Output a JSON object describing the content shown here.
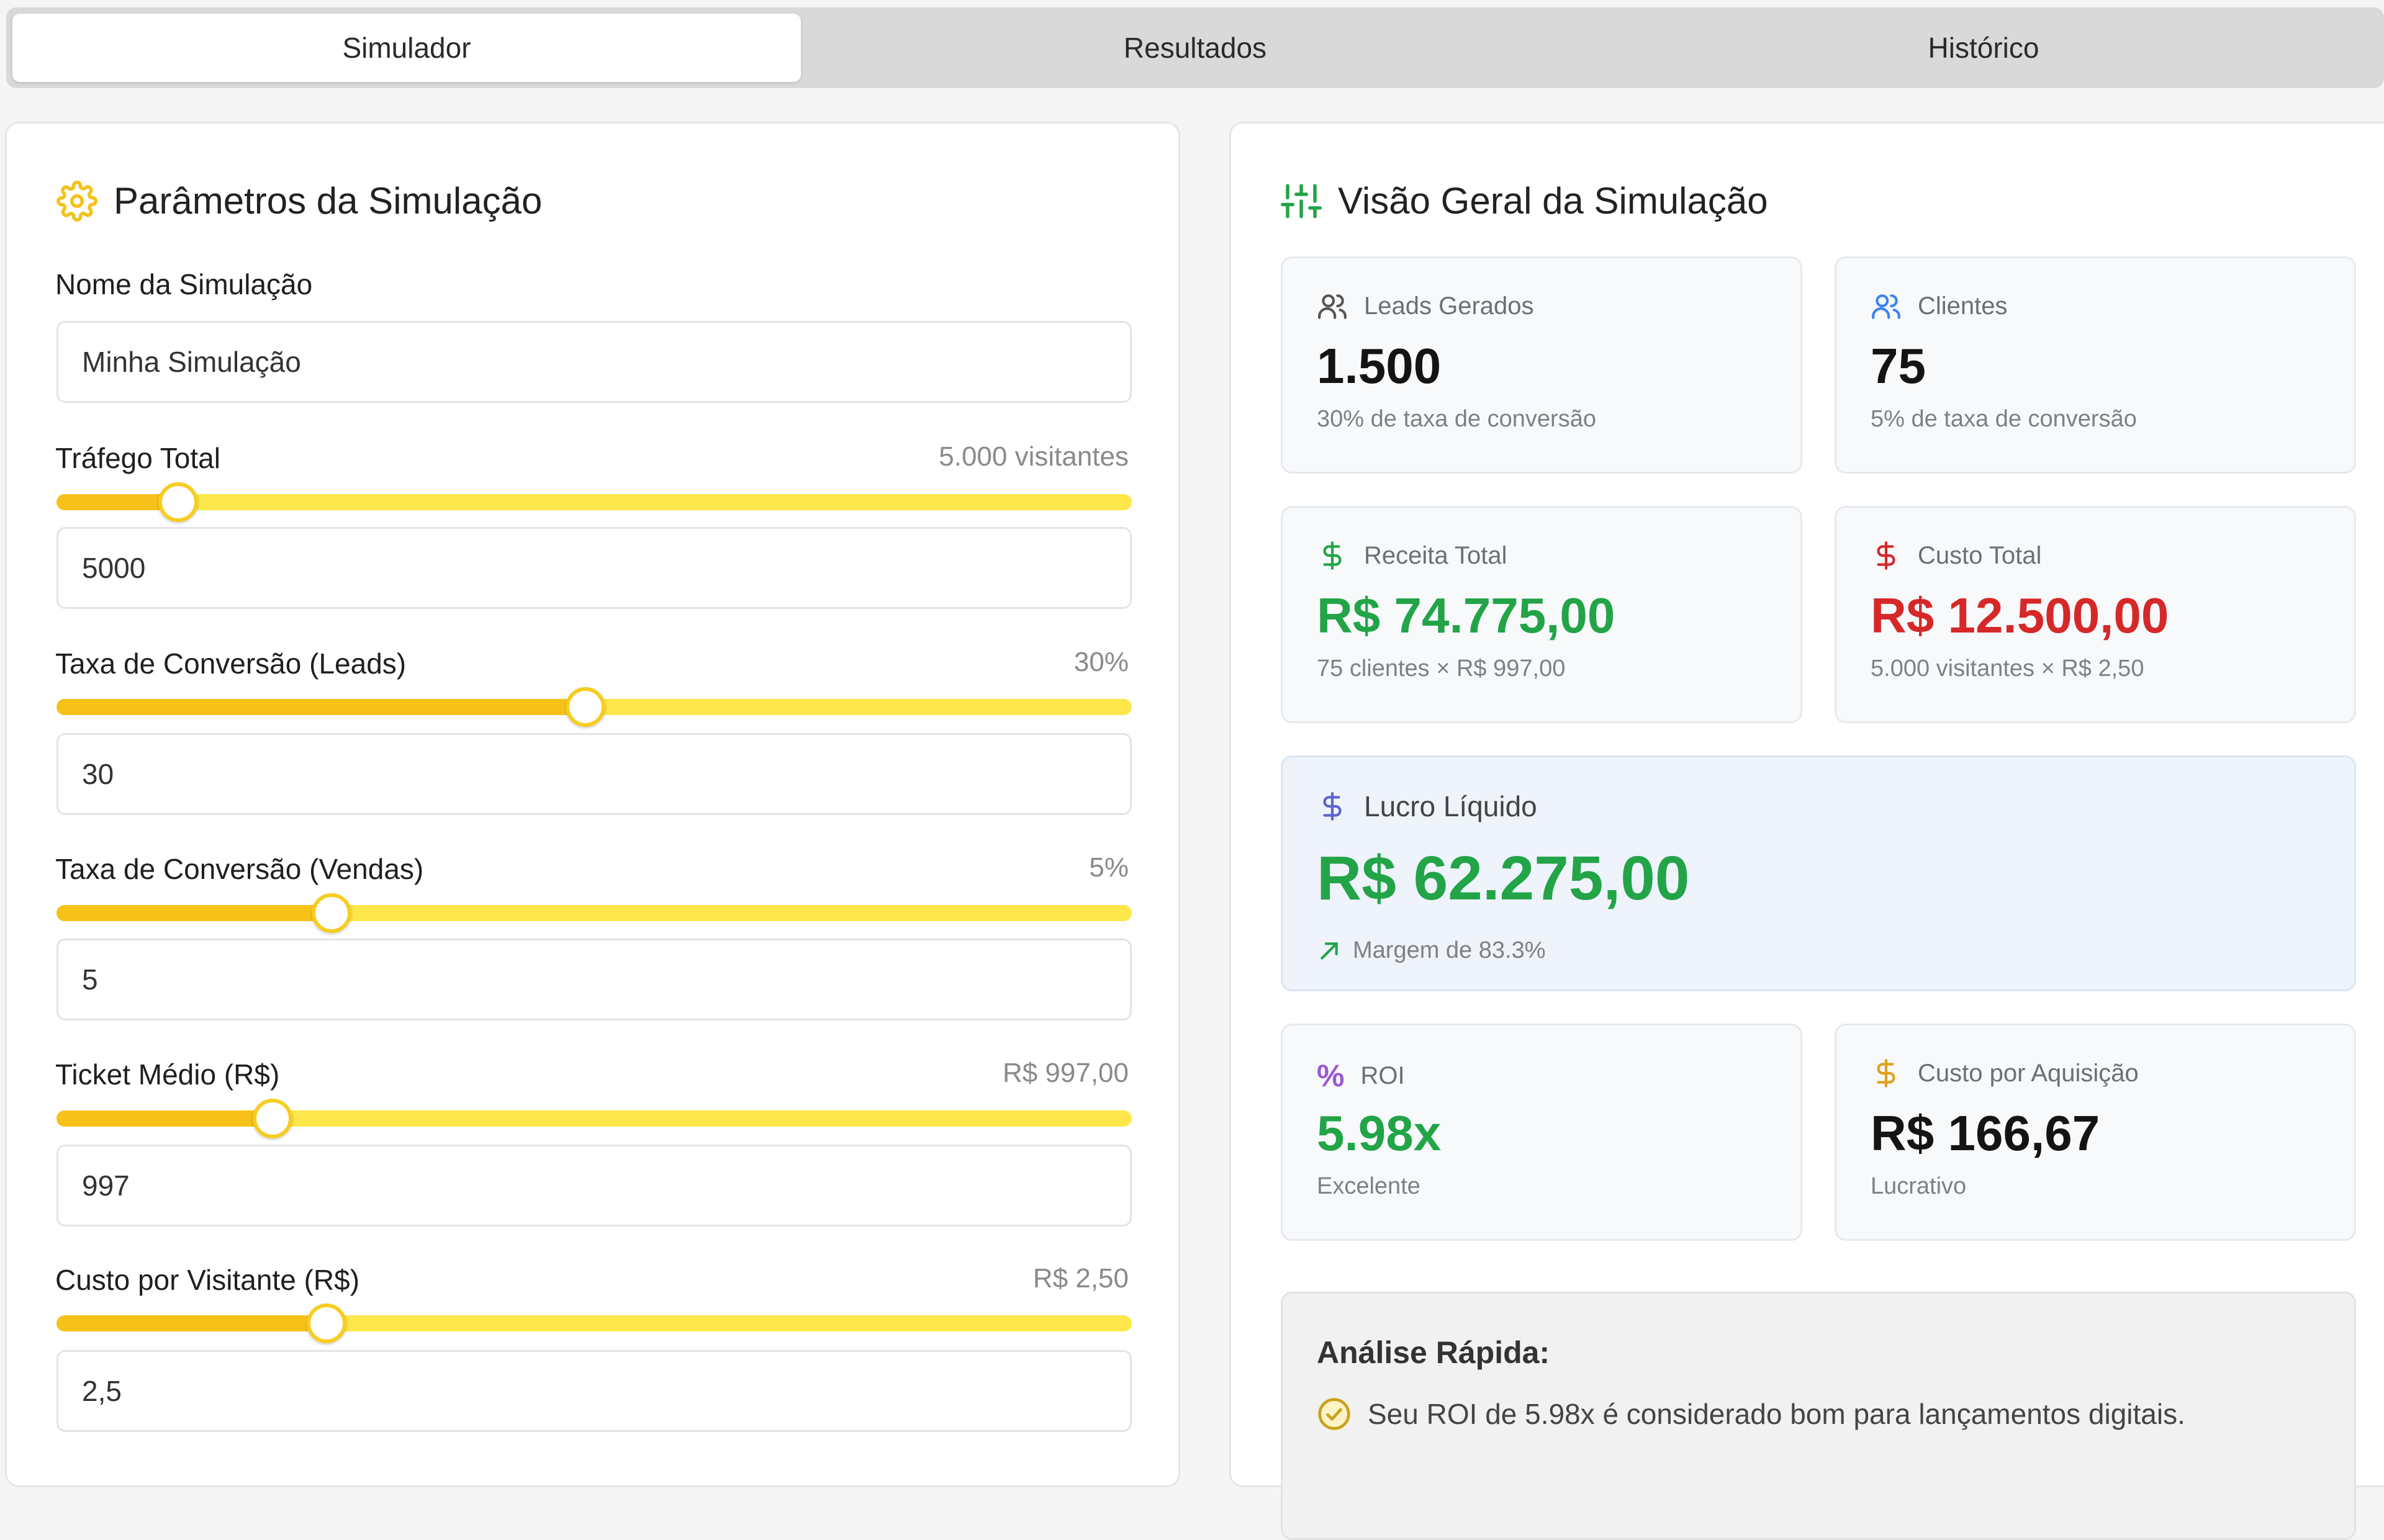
{
  "tabs": [
    "Simulador",
    "Resultados",
    "Histórico"
  ],
  "left_panel": {
    "title": "Parâmetros da Simulação",
    "icon": "gear-icon",
    "name_label": "Nome da Simulação",
    "name_value": "Minha Simulação",
    "fields": [
      {
        "label": "Tráfego Total",
        "display": "5.000 visitantes",
        "input": "5000",
        "slider_fraction": 0.113
      },
      {
        "label": "Taxa de Conversão (Leads)",
        "display": "30%",
        "input": "30",
        "slider_fraction": 0.492
      },
      {
        "label": "Taxa de Conversão (Vendas)",
        "display": "5%",
        "input": "5",
        "slider_fraction": 0.256
      },
      {
        "label": "Ticket Médio (R$)",
        "display": "R$ 997,00",
        "input": "997",
        "slider_fraction": 0.201
      },
      {
        "label": "Custo por Visitante (R$)",
        "display": "R$ 2,50",
        "input": "2,5",
        "slider_fraction": 0.251
      }
    ]
  },
  "right_panel": {
    "title": "Visão Geral da Simulação",
    "icon": "sliders-icon",
    "leads": {
      "label": "Leads Gerados",
      "value": "1.500",
      "sub": "30% de taxa de conversão"
    },
    "clients": {
      "label": "Clientes",
      "value": "75",
      "sub": "5% de taxa de conversão"
    },
    "revenue": {
      "label": "Receita Total",
      "value": "R$ 74.775,00",
      "sub": "75 clientes × R$ 997,00"
    },
    "cost": {
      "label": "Custo Total",
      "value": "R$ 12.500,00",
      "sub": "5.000 visitantes × R$ 2,50"
    },
    "profit": {
      "label": "Lucro Líquido",
      "value": "R$ 62.275,00",
      "sub": "Margem de 83.3%"
    },
    "roi": {
      "label": "ROI",
      "value": "5.98x",
      "sub": "Excelente"
    },
    "cpa": {
      "label": "Custo por Aquisição",
      "value": "R$ 166,67",
      "sub": "Lucrativo"
    },
    "analysis": {
      "title": "Análise Rápida:",
      "line": "Seu ROI de 5.98x é considerado bom para lançamentos digitais."
    }
  },
  "colors": {
    "slider_track": "#fde74a",
    "slider_fill": "#f6c21a",
    "positive": "#22a447",
    "negative": "#d62828"
  }
}
